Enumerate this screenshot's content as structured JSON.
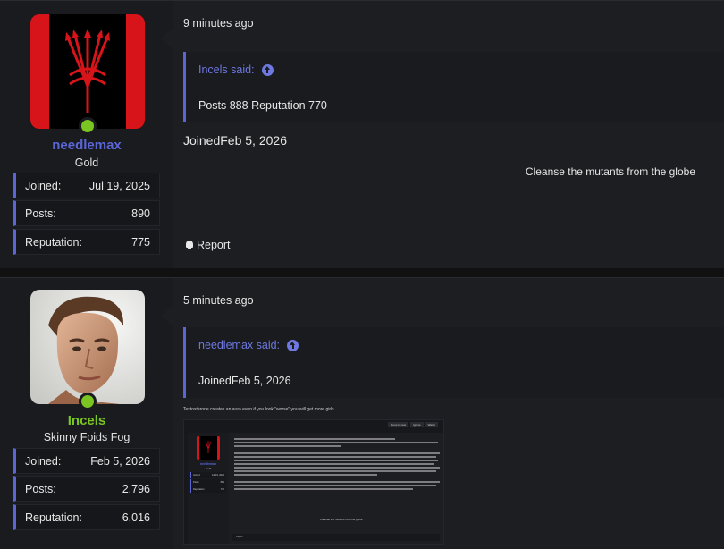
{
  "posts": [
    {
      "user": {
        "name": "needlemax",
        "title": "Gold",
        "stats": [
          {
            "label": "Joined:",
            "value": "Jul 19, 2025"
          },
          {
            "label": "Posts:",
            "value": "890"
          },
          {
            "label": "Reputation:",
            "value": "775"
          }
        ]
      },
      "time": "9 minutes ago",
      "quote": {
        "author": "Incels said:",
        "body": "Posts 888 Reputation 770"
      },
      "text": "JoinedFeb 5, 2026",
      "signature": "Cleanse the mutants from the globe",
      "report_label": "Report"
    },
    {
      "user": {
        "name": "Incels",
        "title": "Skinny Foids Fog",
        "stats": [
          {
            "label": "Joined:",
            "value": "Feb 5, 2026"
          },
          {
            "label": "Posts:",
            "value": "2,796"
          },
          {
            "label": "Reputation:",
            "value": "6,016"
          }
        ]
      },
      "time": "5 minutes ago",
      "quote": {
        "author": "needlemax said:",
        "body": "JoinedFeb 5, 2026"
      },
      "text": "Testosterone creates an aura even if you look \"worse\" you will get more girls.",
      "embed": {
        "buttons": [
          "Jump to new",
          "Ignore",
          "Watch"
        ],
        "name": "needlemax",
        "rank": "Gold",
        "stats": [
          {
            "label": "Joined",
            "value": "Jul 19, 2025"
          },
          {
            "label": "Posts",
            "value": "889"
          },
          {
            "label": "Reputation",
            "value": "772"
          }
        ],
        "signature": "Cleanse the mutants from the globe",
        "footer": "Report"
      }
    }
  ],
  "colors": {
    "accent": "#5b66d6",
    "online": "#7ac522",
    "flag_red": "#d6141a"
  }
}
